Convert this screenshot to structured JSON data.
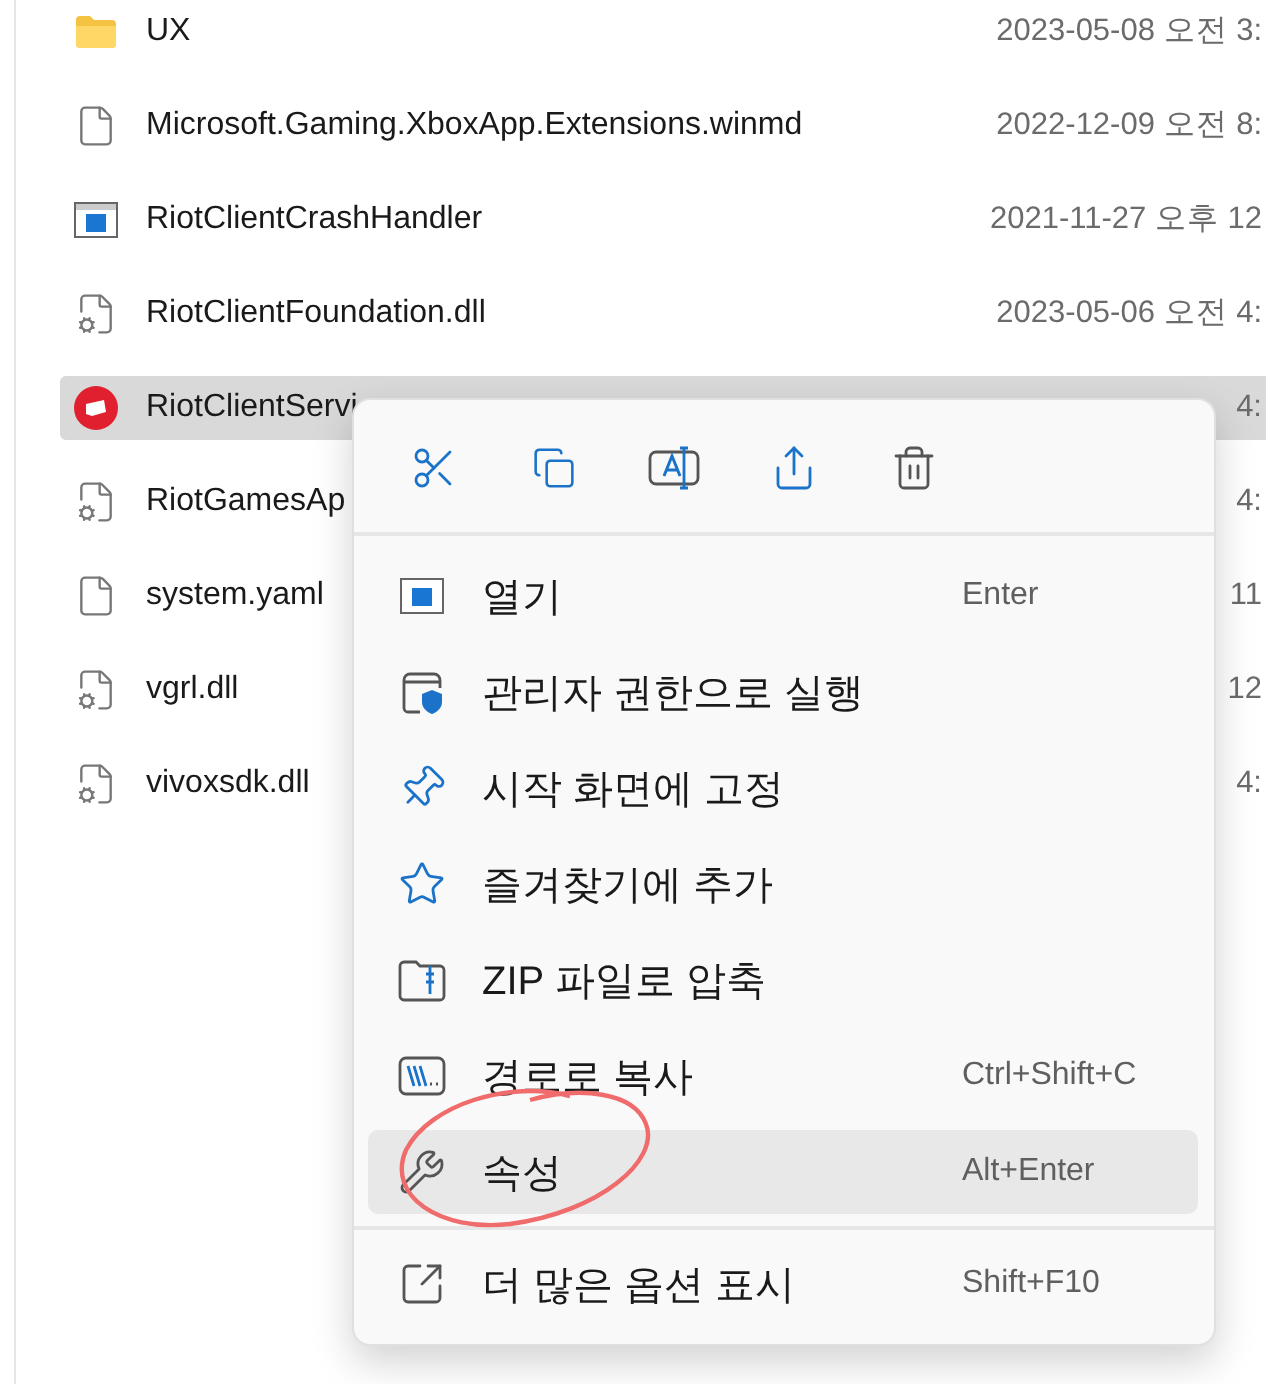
{
  "files": [
    {
      "name": "UX",
      "date": "2023-05-08 오전 3:",
      "kind": "folder",
      "selected": false
    },
    {
      "name": "Microsoft.Gaming.XboxApp.Extensions.winmd",
      "date": "2022-12-09 오전 8:",
      "kind": "file",
      "selected": false
    },
    {
      "name": "RiotClientCrashHandler",
      "date": "2021-11-27 오후 12",
      "kind": "app",
      "selected": false
    },
    {
      "name": "RiotClientFoundation.dll",
      "date": "2023-05-06 오전 4:",
      "kind": "dll",
      "selected": false
    },
    {
      "name": "RiotClientServi",
      "date": "4:",
      "kind": "riot",
      "selected": true
    },
    {
      "name": "RiotGamesAp",
      "date": "4:",
      "kind": "dll",
      "selected": false
    },
    {
      "name": "system.yaml",
      "date": "11",
      "kind": "file",
      "selected": false
    },
    {
      "name": "vgrl.dll",
      "date": "12",
      "kind": "dll",
      "selected": false
    },
    {
      "name": "vivoxsdk.dll",
      "date": "4:",
      "kind": "dll",
      "selected": false
    }
  ],
  "context_menu": {
    "toolbar": [
      {
        "kind": "cut"
      },
      {
        "kind": "copy"
      },
      {
        "kind": "rename"
      },
      {
        "kind": "share"
      },
      {
        "kind": "delete"
      }
    ],
    "items": [
      {
        "kind": "open",
        "label": "열기",
        "shortcut": "Enter",
        "highlighted": false
      },
      {
        "kind": "admin",
        "label": "관리자 권한으로 실행",
        "highlighted": false
      },
      {
        "kind": "pin",
        "label": "시작 화면에 고정",
        "highlighted": false
      },
      {
        "kind": "favorite",
        "label": "즐겨찾기에 추가",
        "highlighted": false
      },
      {
        "kind": "zip",
        "label": "ZIP 파일로 압축",
        "highlighted": false
      },
      {
        "kind": "path",
        "label": "경로로 복사",
        "shortcut": "Ctrl+Shift+C",
        "highlighted": false
      },
      {
        "kind": "properties",
        "label": "속성",
        "shortcut": "Alt+Enter",
        "highlighted": true
      }
    ],
    "more": {
      "kind": "more",
      "label": "더 많은 옵션 표시",
      "shortcut": "Shift+F10"
    }
  },
  "annotation": {
    "kind": "circle"
  }
}
